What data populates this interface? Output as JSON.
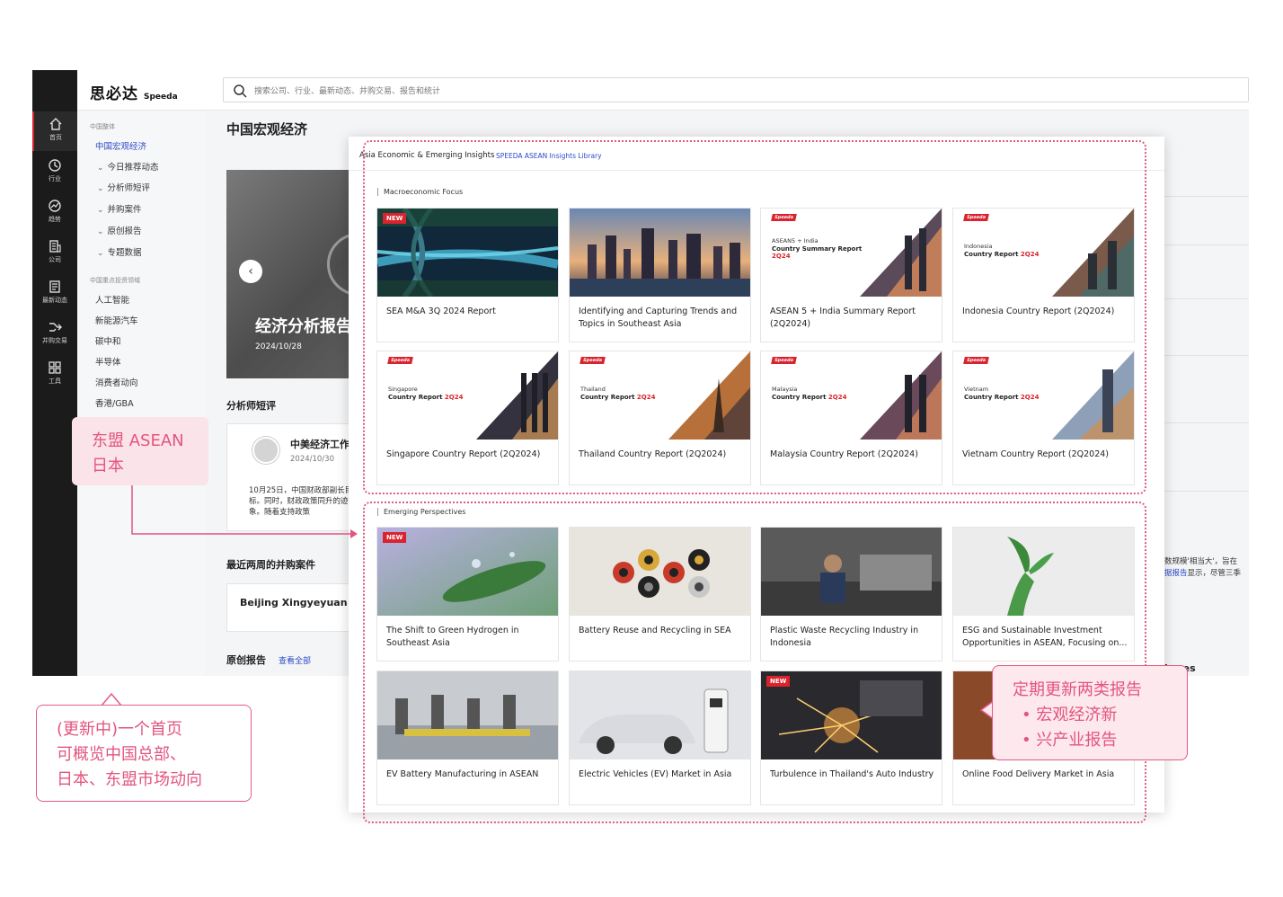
{
  "app": {
    "logo_cn": "思必达",
    "logo_en": "Speeda",
    "search_placeholder": "搜索公司、行业、最新动态、并购交易、报告和统计",
    "leftnav": [
      {
        "label": "首页",
        "icon": "home-icon"
      },
      {
        "label": "行业",
        "icon": "clock-icon"
      },
      {
        "label": "趋势",
        "icon": "trend-icon"
      },
      {
        "label": "公司",
        "icon": "building-icon"
      },
      {
        "label": "最新动态",
        "icon": "news-icon"
      },
      {
        "label": "并购交易",
        "icon": "merge-icon"
      },
      {
        "label": "工具",
        "icon": "grid-icon"
      }
    ],
    "sidenav": {
      "section1": "中国整体",
      "item_macro": "中国宏观经济",
      "subs": [
        "今日推荐动态",
        "分析师短评",
        "并购案件",
        "原创报告",
        "专题数据"
      ],
      "section2": "中国重点投资领域",
      "fields": [
        "人工智能",
        "新能源汽车",
        "碳中和",
        "半导体",
        "消费者动向",
        "香港/GBA"
      ]
    },
    "main": {
      "page_title": "中国宏观经济",
      "hero_title": "经济分析报告",
      "hero_date": "2024/10/28",
      "analyst_heading": "分析师短评",
      "comment_title": "中美经济工作",
      "comment_date": "2024/10/30",
      "comment_body": "10月25日，中国财政部副长目标。同时，财政政策同升的迹象。随着支持政策",
      "deals_heading": "最近两周的并购案件",
      "deal_name": "Beijing Xingyeyuan",
      "reports_heading": "原创报告",
      "view_all": "查看全部",
      "peek_text1": "数规模'相当大'，旨在",
      "peek_text2_link": "据报告",
      "peek_text2_rest": "显示，尽管三季",
      "peek_shares": "hares"
    }
  },
  "panel": {
    "title": "Asia Economic & Emerging Insights",
    "library_link": "SPEEDA ASEAN Insights Library",
    "macro_label": "Macroeconomic Focus",
    "emerging_label": "Emerging Perspectives",
    "new_badge": "NEW",
    "speeda_tag": "Speeda",
    "macro_cards": [
      {
        "title": "SEA M&A 3Q 2024 Report",
        "new": true
      },
      {
        "title": "Identifying and Capturing Trends and Topics in Southeast Asia"
      },
      {
        "title": "ASEAN 5 + India Summary Report (2Q2024)",
        "cover_sub": "ASEAN5 + India",
        "cover_main": "Country Summary Report",
        "cover_period": "2Q24"
      },
      {
        "title": "Indonesia Country Report (2Q2024)",
        "cover_sub": "Indonesia",
        "cover_main": "Country Report",
        "cover_period": "2Q24"
      },
      {
        "title": "Singapore Country Report (2Q2024)",
        "cover_sub": "Singapore",
        "cover_main": "Country Report",
        "cover_period": "2Q24"
      },
      {
        "title": "Thailand Country Report (2Q2024)",
        "cover_sub": "Thailand",
        "cover_main": "Country Report",
        "cover_period": "2Q24"
      },
      {
        "title": "Malaysia Country Report (2Q2024)",
        "cover_sub": "Malaysia",
        "cover_main": "Country Report",
        "cover_period": "2Q24"
      },
      {
        "title": "Vietnam Country Report (2Q2024)",
        "cover_sub": "Vietnam",
        "cover_main": "Country Report",
        "cover_period": "2Q24"
      }
    ],
    "emerging_cards": [
      {
        "title": "The Shift to Green Hydrogen in Southeast Asia",
        "new": true
      },
      {
        "title": "Battery Reuse and Recycling in SEA"
      },
      {
        "title": "Plastic Waste Recycling Industry in Indonesia"
      },
      {
        "title": "ESG and Sustainable Investment Opportunities in ASEAN, Focusing on..."
      },
      {
        "title": "EV Battery Manufacturing in ASEAN"
      },
      {
        "title": "Electric Vehicles (EV) Market in Asia"
      },
      {
        "title": "Turbulence in Thailand's Auto Industry",
        "new": true
      },
      {
        "title": "Online Food Delivery Market in Asia"
      }
    ]
  },
  "notes": {
    "left": [
      "东盟 ASEAN",
      "日本"
    ],
    "bottom": [
      "(更新中)一个首页",
      "可概览中国总部、",
      "日本、东盟市场动向"
    ],
    "right_title": "定期更新两类报告",
    "right_items": [
      "宏观经济新",
      "兴产业报告"
    ]
  },
  "colors": {
    "accent_red": "#d9232e",
    "annotation_pink": "#e2557f",
    "link_blue": "#2c4bc7",
    "nav_dark": "#1b1b1b"
  }
}
